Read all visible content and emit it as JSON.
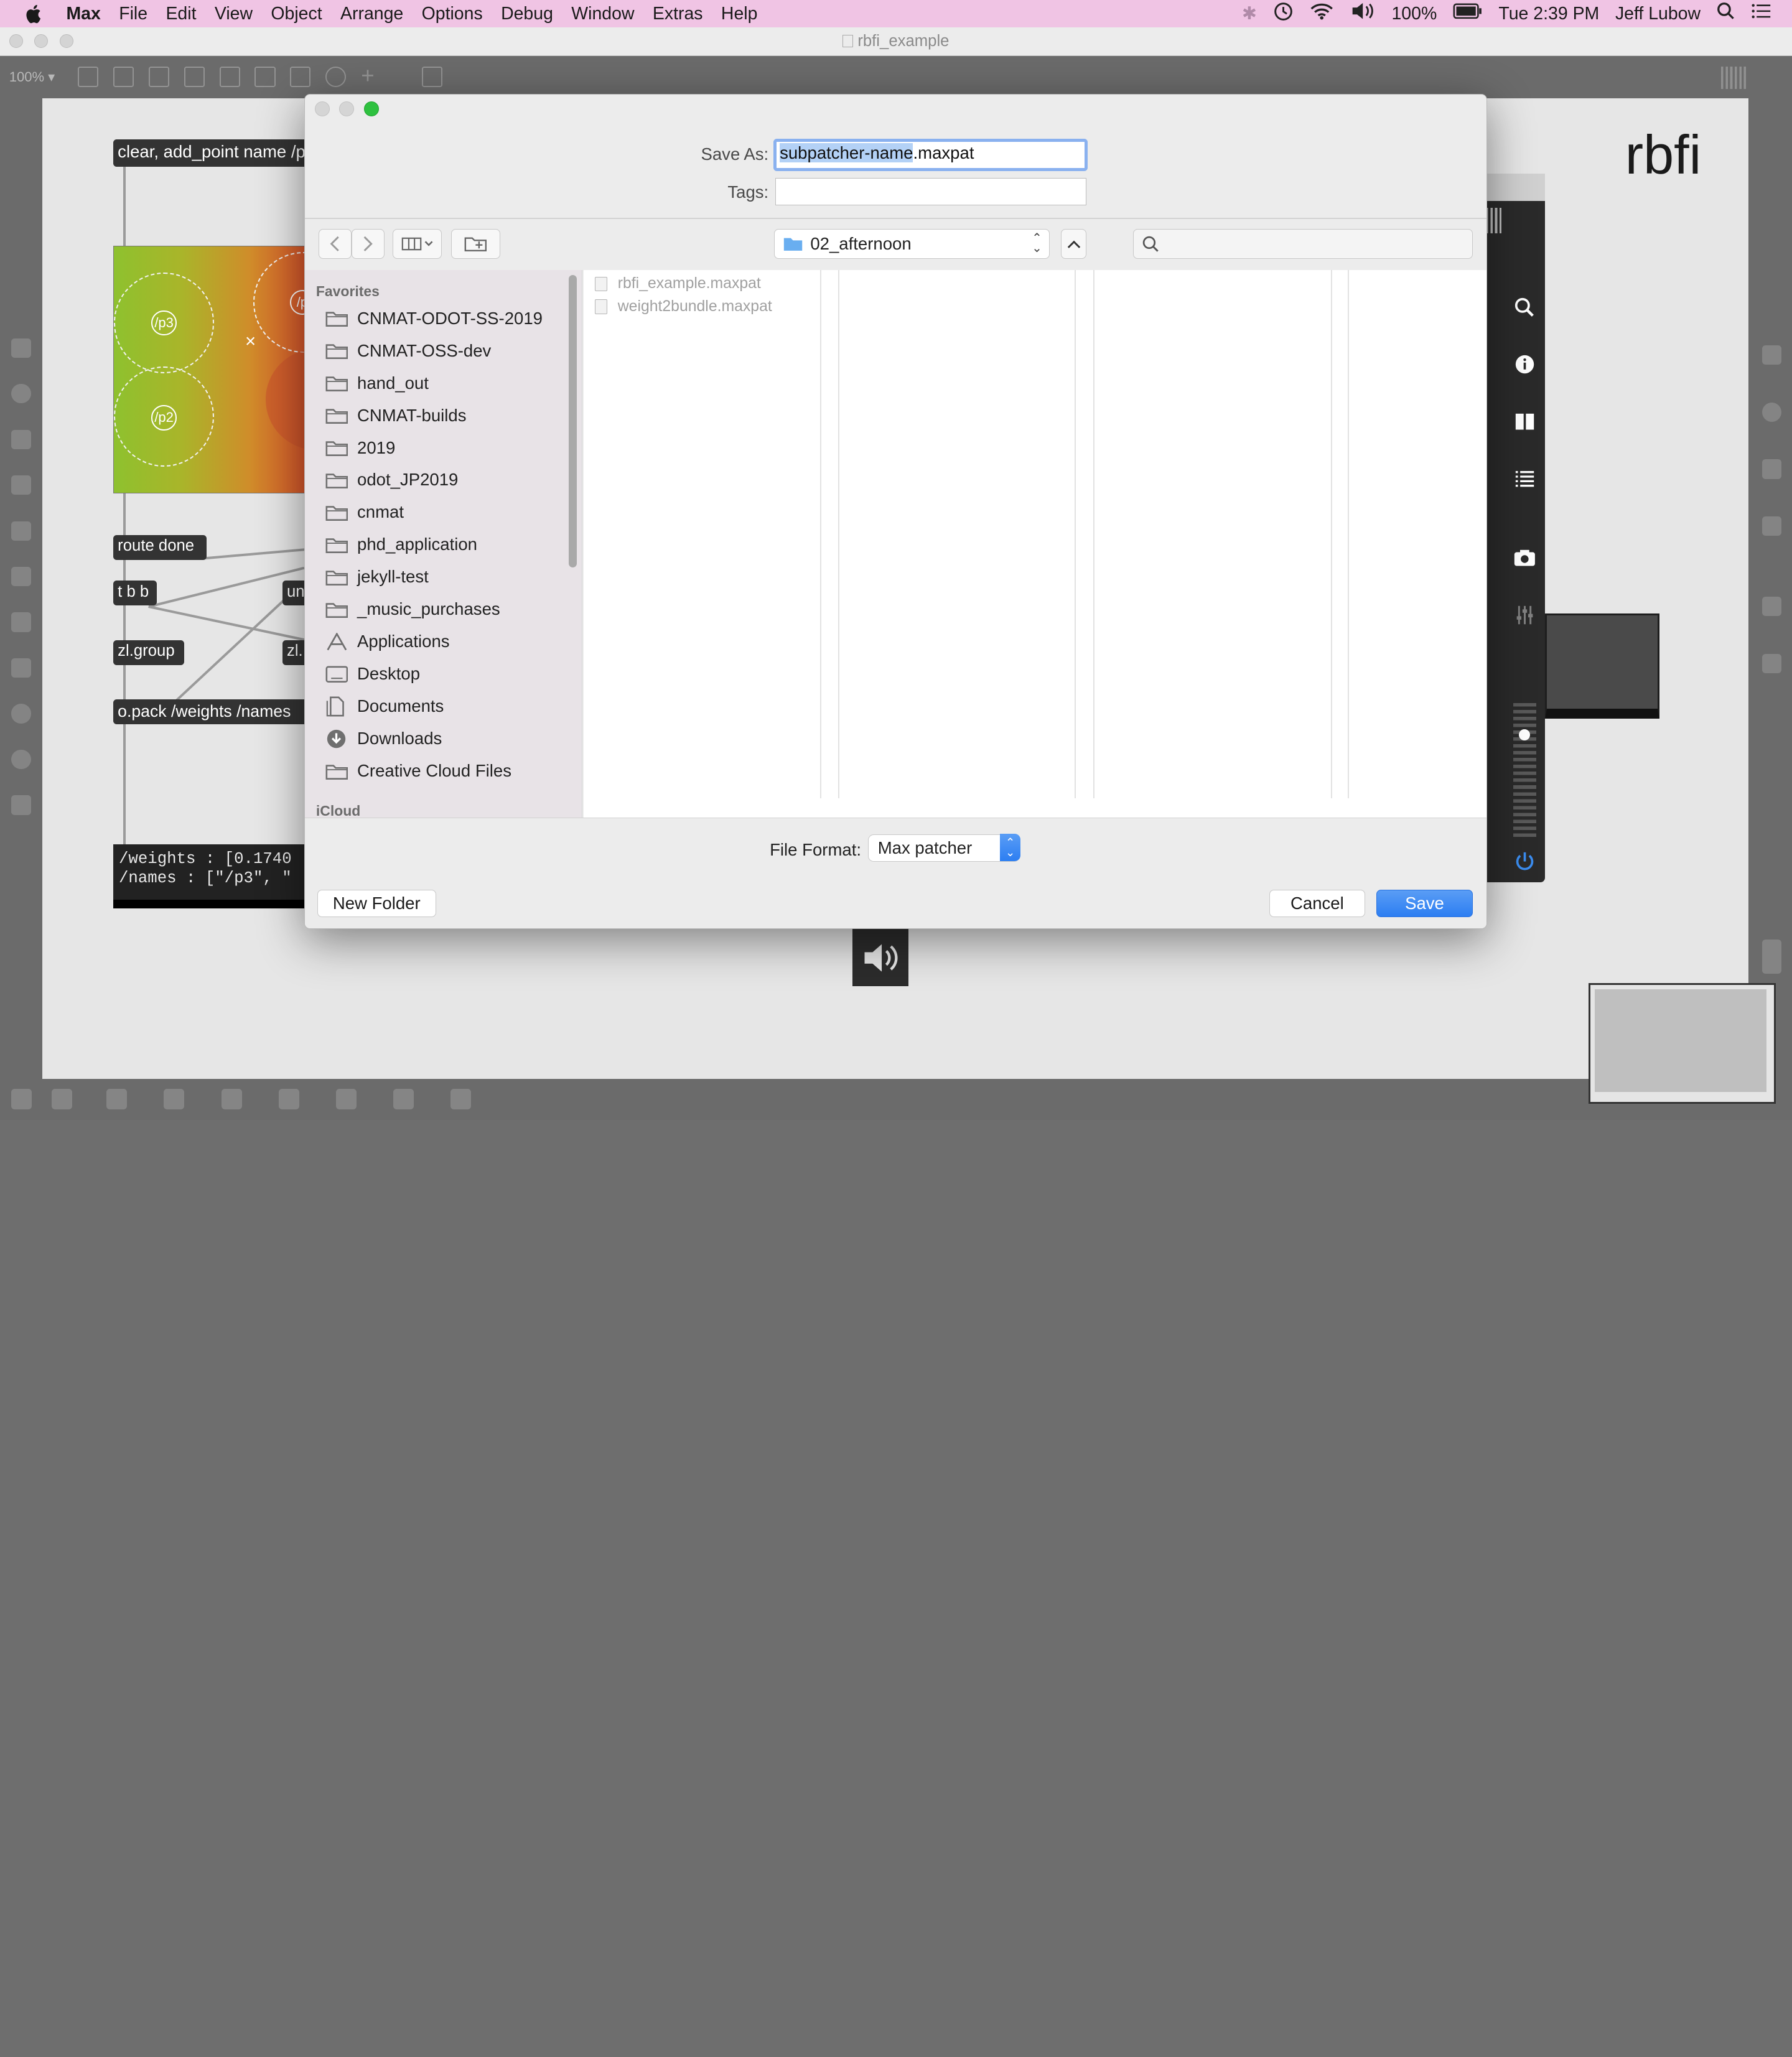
{
  "menubar": {
    "app_name": "Max",
    "items": [
      "File",
      "Edit",
      "View",
      "Object",
      "Arrange",
      "Options",
      "Debug",
      "Window",
      "Extras",
      "Help"
    ],
    "battery": "100%",
    "clock": "Tue 2:39 PM",
    "user": "Jeff Lubow"
  },
  "window": {
    "title": "rbfi_example"
  },
  "toolbar": {
    "zoom": "100% ▾"
  },
  "patcher": {
    "heading": "rbfi",
    "objects": {
      "message_clear": "clear, add_point name /p",
      "route_done": "route done",
      "tbb": "t b b",
      "un": "un",
      "zl_group": "zl.group",
      "zl_partial": "zl.",
      "opack": "o.pack /weights /names"
    },
    "points": {
      "p3": "/p3",
      "p2": "/p2",
      "p1_partial": "/p",
      "cross": "×"
    },
    "display": "/weights : [0.1740\n/names : [\"/p3\", \""
  },
  "dialog": {
    "save_as_label": "Save As:",
    "save_as_selected": "subpatcher-name",
    "save_as_ext": ".maxpat",
    "tags_label": "Tags:",
    "tags_value": "",
    "location": "02_afternoon",
    "search_placeholder": "",
    "favorites_header": "Favorites",
    "favorites": [
      {
        "label": "CNMAT-ODOT-SS-2019",
        "icon": "folder-icon"
      },
      {
        "label": "CNMAT-OSS-dev",
        "icon": "folder-icon"
      },
      {
        "label": "hand_out",
        "icon": "folder-icon"
      },
      {
        "label": "CNMAT-builds",
        "icon": "folder-icon"
      },
      {
        "label": "2019",
        "icon": "folder-icon"
      },
      {
        "label": "odot_JP2019",
        "icon": "folder-icon"
      },
      {
        "label": "cnmat",
        "icon": "folder-icon"
      },
      {
        "label": "phd_application",
        "icon": "folder-icon"
      },
      {
        "label": "jekyll-test",
        "icon": "folder-icon"
      },
      {
        "label": "_music_purchases",
        "icon": "folder-icon"
      },
      {
        "label": "Applications",
        "icon": "applications-icon"
      },
      {
        "label": "Desktop",
        "icon": "desktop-icon"
      },
      {
        "label": "Documents",
        "icon": "documents-icon"
      },
      {
        "label": "Downloads",
        "icon": "downloads-icon"
      },
      {
        "label": "Creative Cloud Files",
        "icon": "folder-icon"
      }
    ],
    "icloud_header": "iCloud",
    "files": [
      "rbfi_example.maxpat",
      "weight2bundle.maxpat"
    ],
    "file_format_label": "File Format:",
    "file_format_value": "Max patcher",
    "new_folder": "New Folder",
    "cancel": "Cancel",
    "save": "Save"
  },
  "colors": {
    "menubar": "#f0c4e4",
    "accent": "#2c7ef2",
    "selection": "#b3d1f6"
  }
}
